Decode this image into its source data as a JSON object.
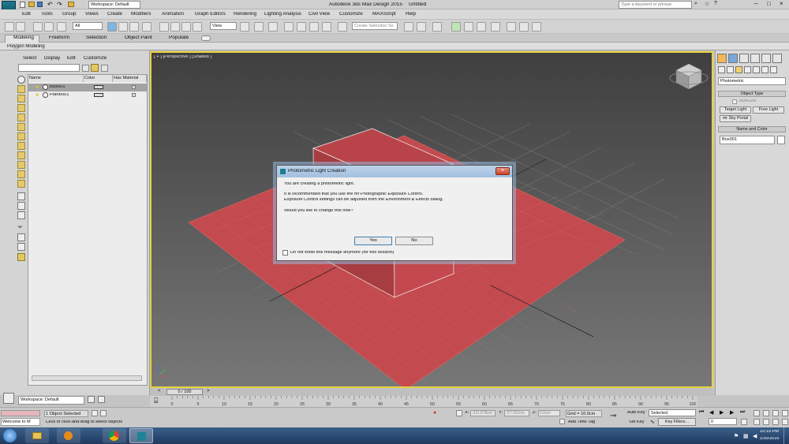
{
  "window": {
    "title": "Autodesk 3ds Max Design 2015",
    "file": "Untitled",
    "workspace": "Workspace: Default",
    "search_placeholder": "Type a keyword or phrase"
  },
  "menu": [
    "Edit",
    "Tools",
    "Group",
    "Views",
    "Create",
    "Modifiers",
    "Animation",
    "Graph Editors",
    "Rendering",
    "Lighting Analysis",
    "Civil View",
    "Customize",
    "MAXScript",
    "Help"
  ],
  "toolbar": {
    "selection_filter": "All",
    "reference_coord": "View",
    "named_selection_placeholder": "Create Selection Se"
  },
  "ribbon": {
    "tabs": [
      "Modeling",
      "Freeform",
      "Selection",
      "Object Paint",
      "Populate"
    ],
    "subtab": "Polygon Modeling"
  },
  "explorer": {
    "menu": [
      "Select",
      "Display",
      "Edit",
      "Customize"
    ],
    "columns": [
      "Name",
      "Color",
      "Has Material"
    ],
    "rows": [
      "Box001",
      "Plane001"
    ],
    "workspace": "Workspace: Default"
  },
  "viewport": {
    "label": "[ + ] [Perspective ] [Shaded ]",
    "box_color": "#c0494d",
    "plane_color": "#c34a4e",
    "border_color": "#e8d13f"
  },
  "command_panel": {
    "category": "Photometric",
    "object_type_header": "Object Type",
    "autogrid": "AutoGrid",
    "buttons": [
      "Target Light",
      "Free Light",
      "mr Sky Portal"
    ],
    "name_color_header": "Name and Color",
    "name_value": "Box001"
  },
  "dialog": {
    "title": "Photometric Light Creation",
    "line1": "You are creating a photometric light.",
    "line2": "It is recommended that you use the mr Photographic Exposure Control.",
    "line3": "Exposure Control settings can be adjusted from the Environment & Effects dialog.",
    "question": "Would you like to change this now?",
    "yes": "Yes",
    "no": "No",
    "checkbox": "Do not show this message anymore (for this session)"
  },
  "timeline": {
    "frame": "0 / 100",
    "ticks": [
      "0",
      "5",
      "10",
      "15",
      "20",
      "25",
      "30",
      "35",
      "40",
      "45",
      "50",
      "55",
      "60",
      "65",
      "70",
      "75",
      "80",
      "85",
      "90",
      "95",
      "100"
    ]
  },
  "status": {
    "selected": "1 Object Selected",
    "prompt": "Click or click-and-drag to select objects",
    "script_box": "Welcome to M",
    "x": "-311.678cm",
    "y": "-27.152cm",
    "z": "0.0cm",
    "grid": "Grid = 10.0cm",
    "add_time_tag": "Add Time Tag",
    "auto_key": "Auto Key",
    "set_key": "Set Key",
    "key_mode": "Selected",
    "key_filters": "Key Filters...",
    "frame_field": "0"
  },
  "taskbar": {
    "time": "10:19 PM",
    "date": "1/30/2016"
  }
}
